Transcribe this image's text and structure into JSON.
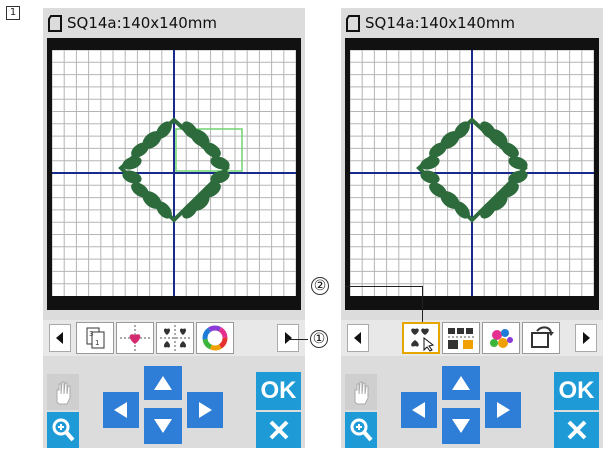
{
  "step_label": "1",
  "screens": [
    {
      "title": "SQ14a:140x140mm",
      "toolbar": {
        "buttons": [
          "layout-icon",
          "center-icon",
          "mirror-icon",
          "color-wheel-icon"
        ]
      }
    },
    {
      "title": "SQ14a:140x140mm",
      "toolbar": {
        "buttons": [
          "select-pattern-icon",
          "array-icon",
          "group-icon",
          "rotate-icon"
        ]
      }
    }
  ],
  "ok_label": "OK",
  "callouts": [
    "①",
    "②"
  ],
  "colors": {
    "grid_line": "#b5b5b5",
    "axis_line": "#1a2a8a",
    "pattern": "#2d6b3c",
    "frame_outline": "#6fd46f",
    "accent_blue": "#1e9bd7",
    "arrow_blue": "#2e7dd6",
    "selected_border": "#e6a600"
  }
}
